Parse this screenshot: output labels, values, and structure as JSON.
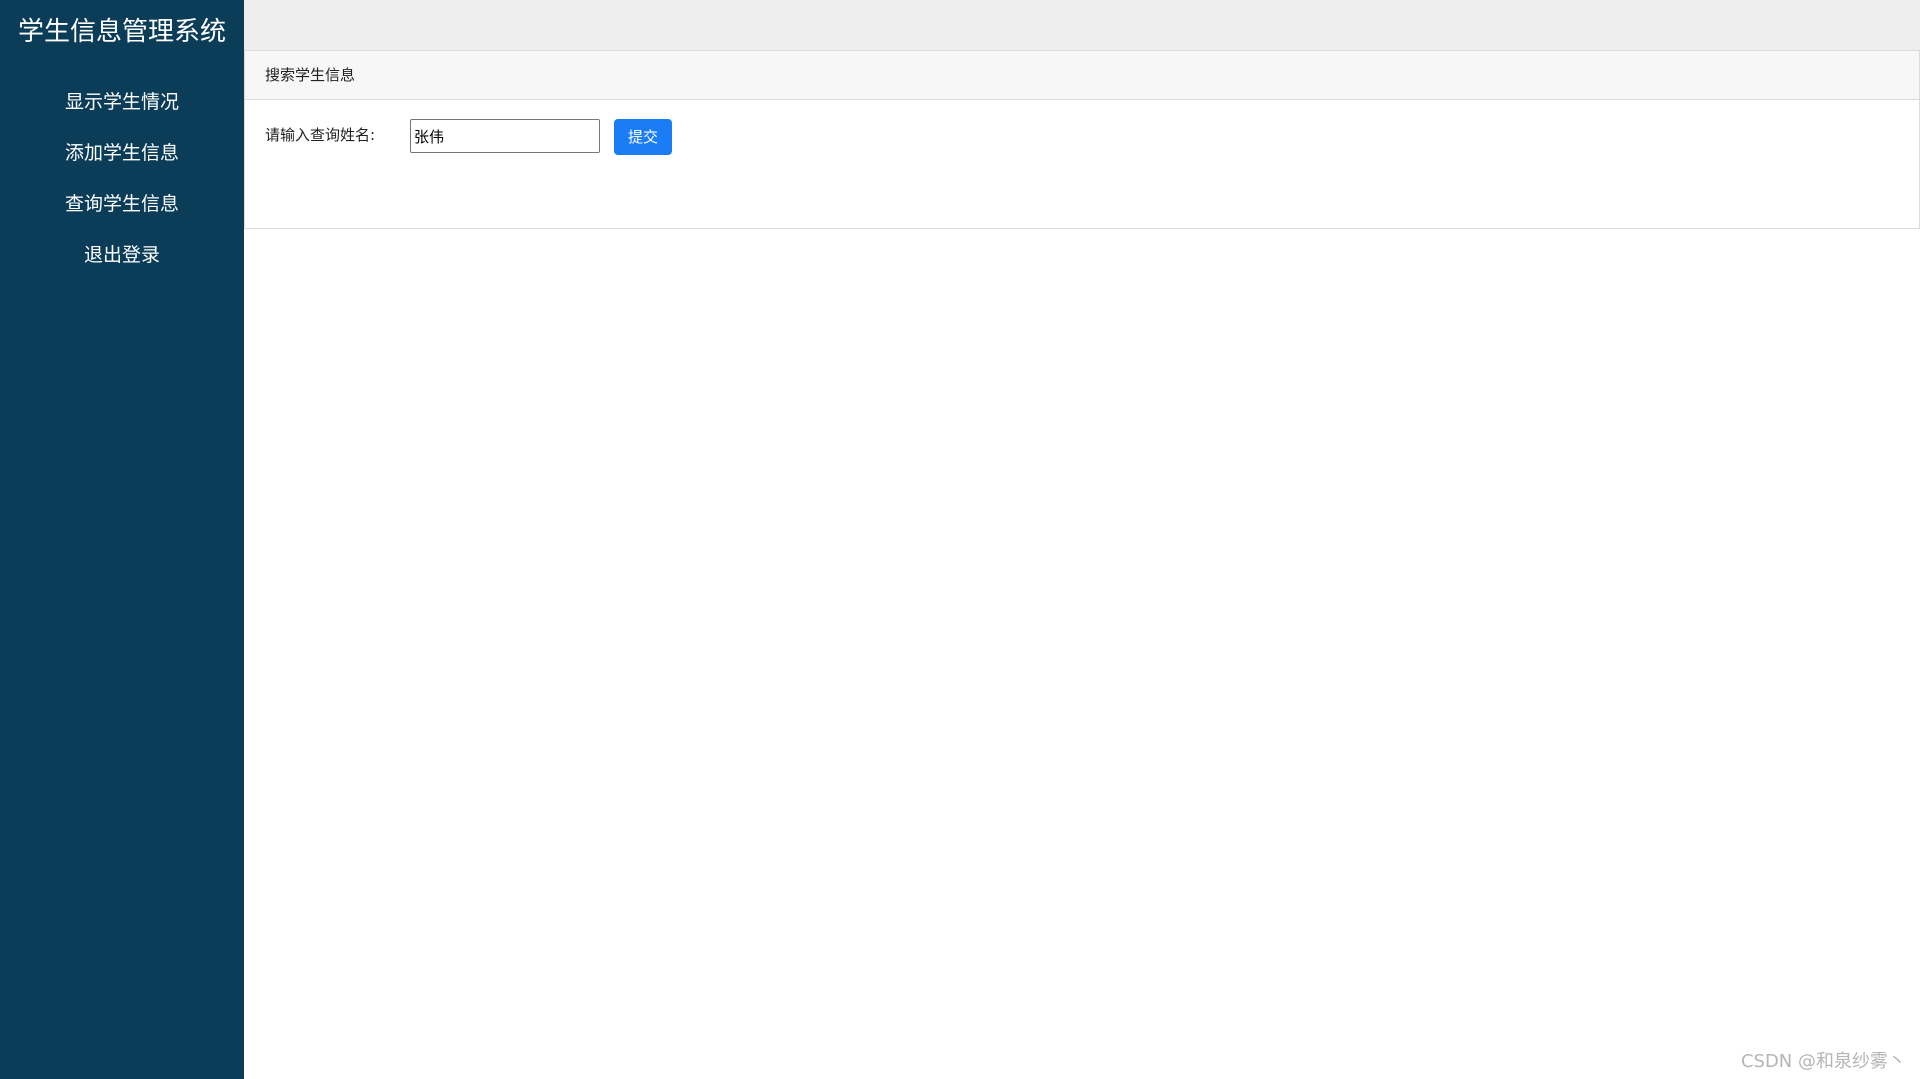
{
  "sidebar": {
    "title": "学生信息管理系统",
    "items": [
      {
        "label": "显示学生情况"
      },
      {
        "label": "添加学生信息"
      },
      {
        "label": "查询学生信息"
      },
      {
        "label": "退出登录"
      }
    ]
  },
  "panel": {
    "header": "搜索学生信息",
    "search_label": "请输入查询姓名:",
    "search_value": "张伟",
    "submit_label": "提交"
  },
  "watermark": "CSDN @和泉纱雾丶",
  "colors": {
    "sidebar_bg": "#0b3c58",
    "button_bg": "#1a7df5",
    "topbar_bg": "#eeeeee"
  }
}
